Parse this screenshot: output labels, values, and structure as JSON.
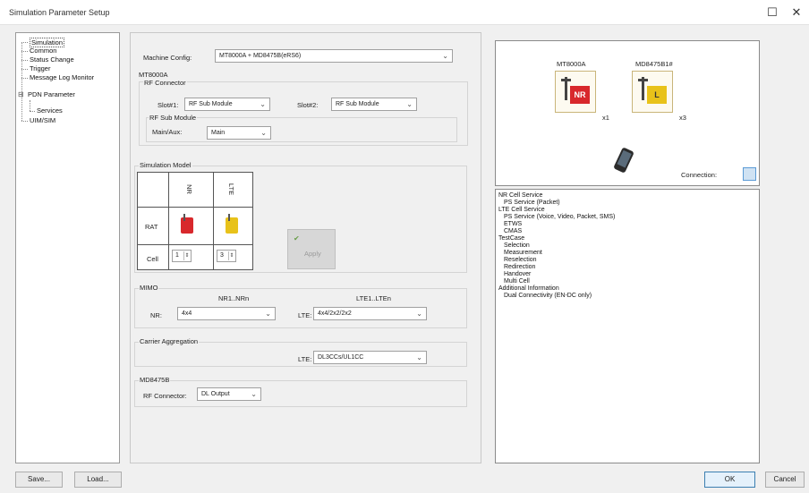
{
  "window": {
    "title": "Simulation Parameter Setup",
    "maximize_glyph": "☐",
    "close_glyph": "✕"
  },
  "tree": {
    "items": [
      "Simulation",
      "Common",
      "Status Change",
      "Trigger",
      "Message Log Monitor",
      "PDN Parameter",
      "Services",
      "UIM/SIM"
    ],
    "expander": "⊟"
  },
  "machine": {
    "label": "Machine Config:",
    "value": "MT8000A + MD8475B(eRS6)"
  },
  "mt8000a": {
    "section": "MT8000A",
    "rf_connector": "RF Connector",
    "slot1_label": "Slot#1:",
    "slot1_value": "RF Sub Module",
    "slot2_label": "Slot#2:",
    "slot2_value": "RF Sub Module",
    "rf_sub_module": "RF Sub Module",
    "main_aux_label": "Main/Aux:",
    "main_aux_value": "Main"
  },
  "simulation_model": {
    "title": "Simulation Model",
    "col_nr": "NR",
    "col_lte": "LTE",
    "row_rat": "RAT",
    "row_cell": "Cell",
    "nr_cell": "1",
    "lte_cell": "3",
    "apply": "Apply"
  },
  "mimo": {
    "title": "MIMO",
    "nr_header": "NR1..NRn",
    "lte_header": "LTE1..LTEn",
    "nr_label": "NR:",
    "nr_value": "4x4",
    "lte_label": "LTE:",
    "lte_value": "4x4/2x2/2x2"
  },
  "ca": {
    "title": "Carrier Aggregation",
    "lte_label": "LTE:",
    "lte_value": "DL3CCs/UL1CC"
  },
  "md8475b": {
    "title": "MD8475B",
    "rf_label": "RF Connector:",
    "rf_value": "DL Output"
  },
  "topology": {
    "mt8000a": "MT8000A",
    "md8475b": "MD8475B1#",
    "nr_badge": "NR",
    "lte_badge": "L",
    "nr_count": "x1",
    "lte_count": "x3",
    "connection_label": "Connection:"
  },
  "services": [
    {
      "text": "NR Cell Service",
      "indent": 0
    },
    {
      "text": "PS Service (Packet)",
      "indent": 1
    },
    {
      "text": "LTE Cell Service",
      "indent": 0
    },
    {
      "text": "PS Service (Voice, Video, Packet, SMS)",
      "indent": 1
    },
    {
      "text": "ETWS",
      "indent": 1
    },
    {
      "text": "CMAS",
      "indent": 1
    },
    {
      "text": "TestCase",
      "indent": 0
    },
    {
      "text": "Selection",
      "indent": 1
    },
    {
      "text": "Measurement",
      "indent": 1
    },
    {
      "text": "Reselection",
      "indent": 1
    },
    {
      "text": "Redirection",
      "indent": 1
    },
    {
      "text": "Handover",
      "indent": 1
    },
    {
      "text": "Multi Cell",
      "indent": 1
    },
    {
      "text": "Additional Information",
      "indent": 0
    },
    {
      "text": "Dual Connectivity (EN-DC only)",
      "indent": 1
    }
  ],
  "buttons": {
    "save": "Save...",
    "load": "Load...",
    "ok": "OK",
    "cancel": "Cancel"
  },
  "colors": {
    "nr_red": "#d8282c",
    "lte_yellow": "#e8c21a",
    "accent_blue": "#5b9bd5"
  }
}
